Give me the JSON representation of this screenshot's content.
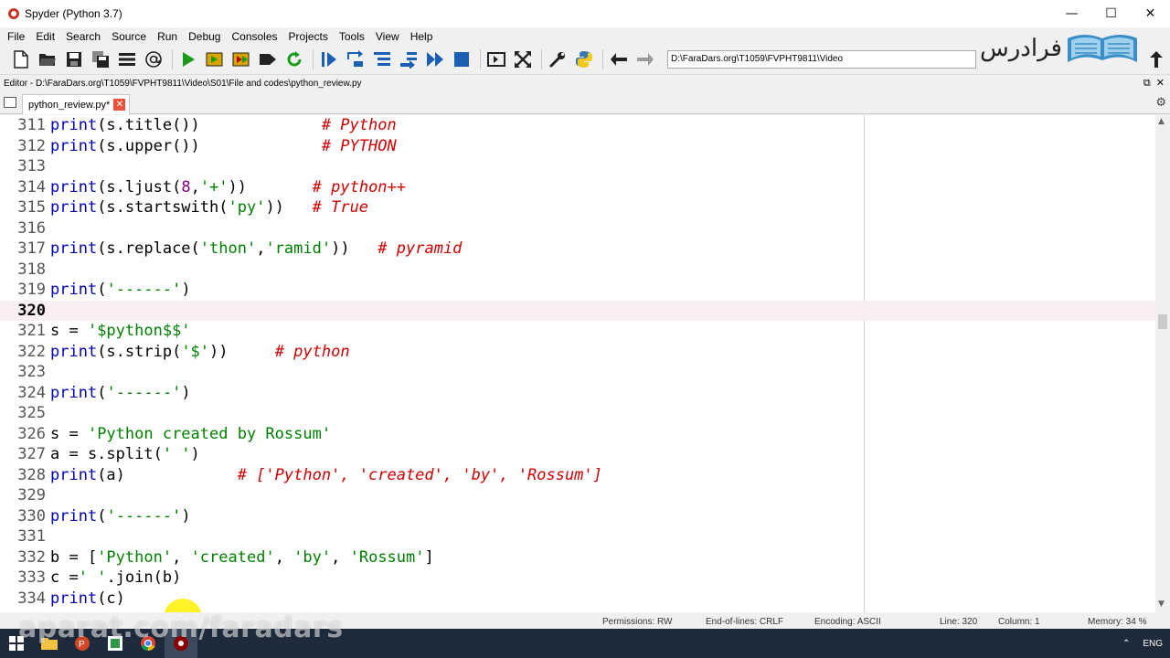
{
  "window": {
    "title": "Spyder (Python 3.7)",
    "minimize": "—",
    "maximize": "☐",
    "close": "✕"
  },
  "menu": [
    "File",
    "Edit",
    "Search",
    "Source",
    "Run",
    "Debug",
    "Consoles",
    "Projects",
    "Tools",
    "View",
    "Help"
  ],
  "toolbar": {
    "working_dir": "D:\\FaraDars.org\\T1059\\FVPHT9811\\Video"
  },
  "logo": {
    "text": "فرادرس"
  },
  "editor_header": {
    "path": "Editor - D:\\FaraDars.org\\T1059\\FVPHT9811\\Video\\S01\\File and codes\\python_review.py"
  },
  "tab": {
    "filename": "python_review.py*"
  },
  "code_lines": [
    {
      "num": "311",
      "tokens": [
        {
          "t": "print",
          "c": "kw"
        },
        {
          "t": "(s.title())             "
        },
        {
          "t": "# Python",
          "c": "cmt"
        }
      ]
    },
    {
      "num": "312",
      "tokens": [
        {
          "t": "print",
          "c": "kw"
        },
        {
          "t": "(s.upper())             "
        },
        {
          "t": "# PYTHON",
          "c": "cmt"
        }
      ]
    },
    {
      "num": "313",
      "tokens": []
    },
    {
      "num": "314",
      "tokens": [
        {
          "t": "print",
          "c": "kw"
        },
        {
          "t": "(s.ljust("
        },
        {
          "t": "8",
          "c": "num"
        },
        {
          "t": ","
        },
        {
          "t": "'+'",
          "c": "str"
        },
        {
          "t": "))       "
        },
        {
          "t": "# python++",
          "c": "cmt"
        }
      ]
    },
    {
      "num": "315",
      "tokens": [
        {
          "t": "print",
          "c": "kw"
        },
        {
          "t": "(s.startswith("
        },
        {
          "t": "'py'",
          "c": "str"
        },
        {
          "t": "))   "
        },
        {
          "t": "# True",
          "c": "cmt"
        }
      ]
    },
    {
      "num": "316",
      "tokens": []
    },
    {
      "num": "317",
      "tokens": [
        {
          "t": "print",
          "c": "kw"
        },
        {
          "t": "(s.replace("
        },
        {
          "t": "'thon'",
          "c": "str"
        },
        {
          "t": ","
        },
        {
          "t": "'ramid'",
          "c": "str"
        },
        {
          "t": "))   "
        },
        {
          "t": "# pyramid",
          "c": "cmt"
        }
      ]
    },
    {
      "num": "318",
      "tokens": []
    },
    {
      "num": "319",
      "tokens": [
        {
          "t": "print",
          "c": "kw"
        },
        {
          "t": "("
        },
        {
          "t": "'------'",
          "c": "str"
        },
        {
          "t": ")"
        }
      ]
    },
    {
      "num": "320",
      "tokens": [],
      "current": true
    },
    {
      "num": "321",
      "tokens": [
        {
          "t": "s = "
        },
        {
          "t": "'$python$$'",
          "c": "str"
        }
      ]
    },
    {
      "num": "322",
      "tokens": [
        {
          "t": "print",
          "c": "kw"
        },
        {
          "t": "(s.strip("
        },
        {
          "t": "'$'",
          "c": "str"
        },
        {
          "t": "))     "
        },
        {
          "t": "# python",
          "c": "cmt"
        }
      ]
    },
    {
      "num": "323",
      "tokens": []
    },
    {
      "num": "324",
      "tokens": [
        {
          "t": "print",
          "c": "kw"
        },
        {
          "t": "("
        },
        {
          "t": "'------'",
          "c": "str"
        },
        {
          "t": ")"
        }
      ]
    },
    {
      "num": "325",
      "tokens": []
    },
    {
      "num": "326",
      "tokens": [
        {
          "t": "s = "
        },
        {
          "t": "'Python created by Rossum'",
          "c": "str"
        }
      ]
    },
    {
      "num": "327",
      "tokens": [
        {
          "t": "a = s.split("
        },
        {
          "t": "' '",
          "c": "str"
        },
        {
          "t": ")"
        }
      ]
    },
    {
      "num": "328",
      "tokens": [
        {
          "t": "print",
          "c": "kw"
        },
        {
          "t": "(a)            "
        },
        {
          "t": "# ['Python', 'created', 'by', 'Rossum']",
          "c": "cmt"
        }
      ]
    },
    {
      "num": "329",
      "tokens": []
    },
    {
      "num": "330",
      "tokens": [
        {
          "t": "print",
          "c": "kw"
        },
        {
          "t": "("
        },
        {
          "t": "'------'",
          "c": "str"
        },
        {
          "t": ")"
        }
      ]
    },
    {
      "num": "331",
      "tokens": []
    },
    {
      "num": "332",
      "tokens": [
        {
          "t": "b = ["
        },
        {
          "t": "'Python'",
          "c": "str"
        },
        {
          "t": ", "
        },
        {
          "t": "'created'",
          "c": "str"
        },
        {
          "t": ", "
        },
        {
          "t": "'by'",
          "c": "str"
        },
        {
          "t": ", "
        },
        {
          "t": "'Rossum'",
          "c": "str"
        },
        {
          "t": "]"
        }
      ]
    },
    {
      "num": "333",
      "tokens": [
        {
          "t": "c ="
        },
        {
          "t": "' '",
          "c": "str"
        },
        {
          "t": ".join(b)"
        }
      ]
    },
    {
      "num": "334",
      "tokens": [
        {
          "t": "print",
          "c": "kw"
        },
        {
          "t": "(c)"
        }
      ]
    }
  ],
  "statusbar": {
    "permissions": "Permissions: RW",
    "eol": "End-of-lines: CRLF",
    "encoding": "Encoding: ASCII",
    "line": "Line: 320",
    "column": "Column: 1",
    "memory": "Memory: 34 %"
  },
  "taskbar": {
    "language": "ENG"
  },
  "watermark": {
    "text": "aparat.com/faradars"
  },
  "colors": {
    "keyword": "#0000bb",
    "string": "#008000",
    "number": "#800080",
    "comment": "#d00000",
    "current_line": "#fbeef3"
  }
}
